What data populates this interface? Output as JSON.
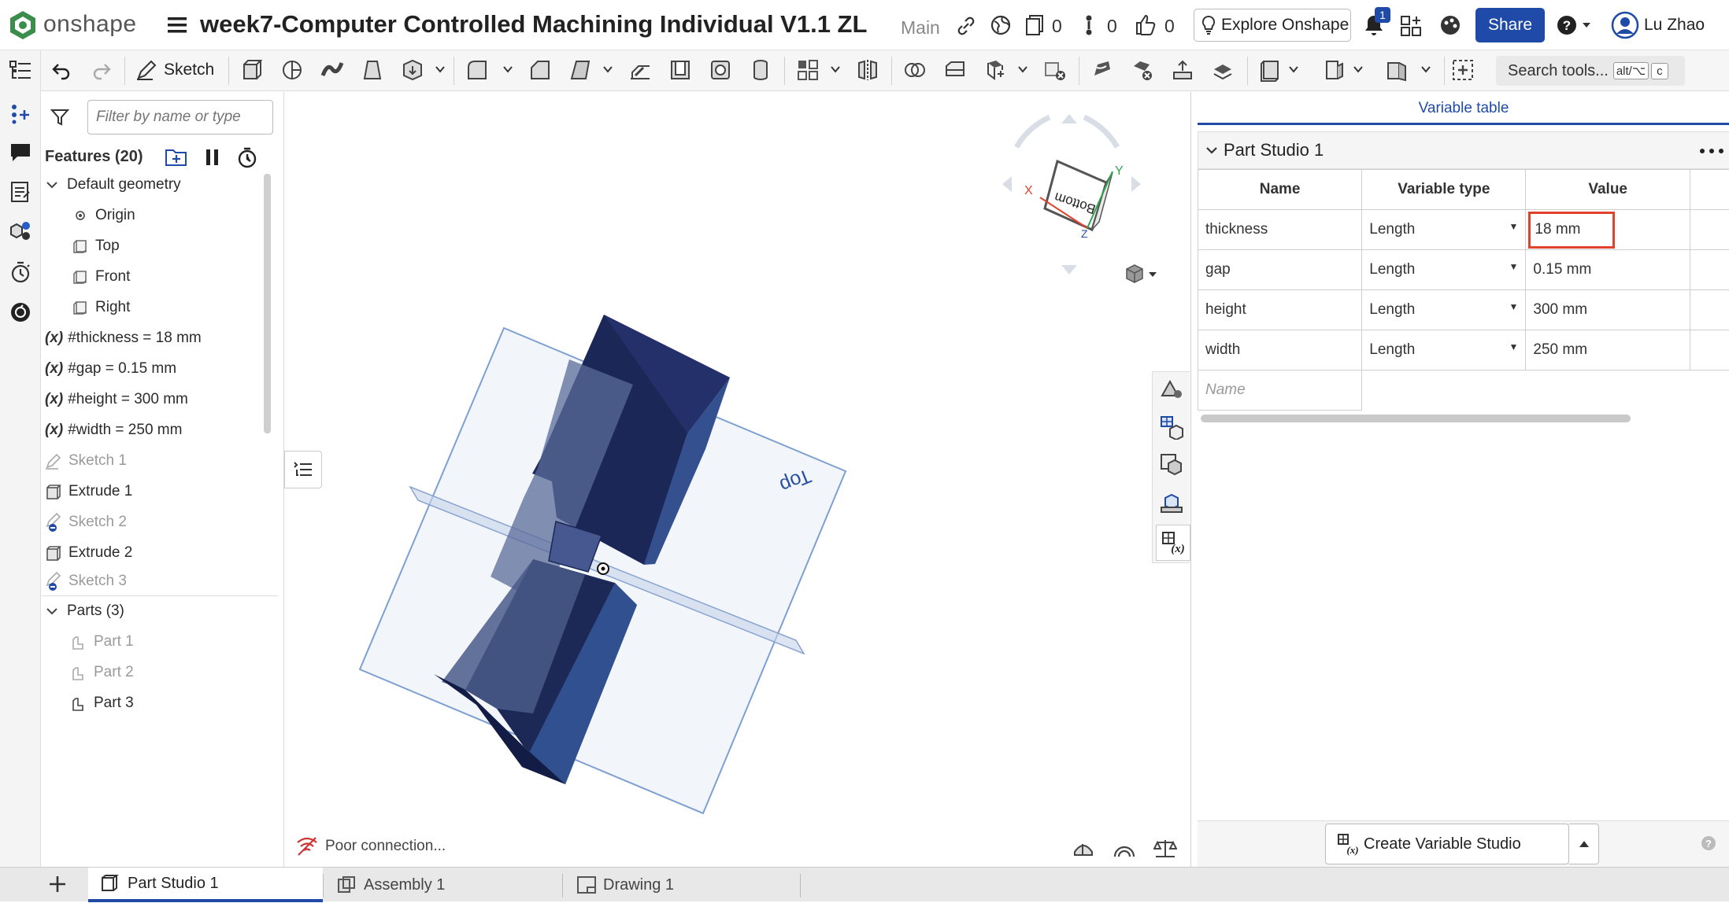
{
  "app": {
    "brand": "onshape",
    "document_title": "week7-Computer Controlled Machining Individual V1.1 ZL",
    "branch": "Main"
  },
  "header": {
    "count_versions": "0",
    "count_branches": "0",
    "count_likes": "0",
    "explore_label": "Explore Onshape",
    "notification_badge": "1",
    "share_label": "Share",
    "user_name": "Lu Zhao"
  },
  "toolbar": {
    "sketch_label": "Sketch",
    "search_label": "Search tools...",
    "search_shortcut_1": "alt/⌥",
    "search_shortcut_2": "c"
  },
  "features": {
    "filter_placeholder": "Filter by name or type",
    "header": "Features (20)",
    "default_geometry": "Default geometry",
    "items": [
      {
        "label": "Origin"
      },
      {
        "label": "Top"
      },
      {
        "label": "Front"
      },
      {
        "label": "Right"
      },
      {
        "label": "#thickness = 18 mm"
      },
      {
        "label": "#gap = 0.15 mm"
      },
      {
        "label": "#height = 300 mm"
      },
      {
        "label": "#width = 250 mm"
      },
      {
        "label": "Sketch 1"
      },
      {
        "label": "Extrude 1"
      },
      {
        "label": "Sketch 2"
      },
      {
        "label": "Extrude 2"
      },
      {
        "label": "Sketch 3"
      }
    ],
    "var_prefix": "(x)",
    "parts_header": "Parts (3)",
    "parts": [
      {
        "label": "Part 1"
      },
      {
        "label": "Part 2"
      },
      {
        "label": "Part 3"
      }
    ]
  },
  "viewport": {
    "plane_label": "Top",
    "viewcube_face": "Bottom",
    "axis_x": "X",
    "axis_y": "Y",
    "axis_z": "Z",
    "status": "Poor connection..."
  },
  "variable_table": {
    "panel_title": "Variable table",
    "studio_name": "Part Studio 1",
    "columns": [
      "Name",
      "Variable type",
      "Value"
    ],
    "rows": [
      {
        "name": "thickness",
        "type": "Length",
        "value": "18 mm"
      },
      {
        "name": "gap",
        "type": "Length",
        "value": "0.15 mm"
      },
      {
        "name": "height",
        "type": "Length",
        "value": "300 mm"
      },
      {
        "name": "width",
        "type": "Length",
        "value": "250 mm"
      }
    ],
    "new_name_placeholder": "Name",
    "create_button": "Create Variable Studio"
  },
  "tabs": [
    {
      "label": "Part Studio 1"
    },
    {
      "label": "Assembly 1"
    },
    {
      "label": "Drawing 1"
    }
  ],
  "colors": {
    "accent": "#1f4aa8",
    "highlight": "#e2422b",
    "part_dark": "#1c2a5a",
    "part_side": "#33509a"
  }
}
